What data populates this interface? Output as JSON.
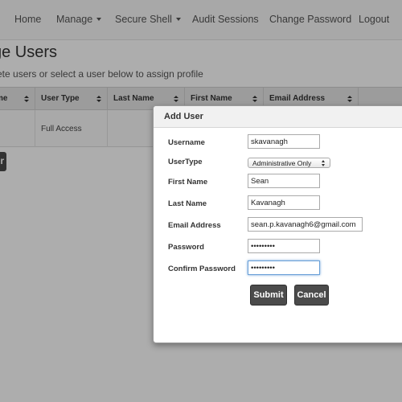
{
  "navbar": {
    "items": [
      {
        "label": "Home"
      },
      {
        "label": "Manage"
      },
      {
        "label": "Secure Shell"
      },
      {
        "label": "Audit Sessions"
      },
      {
        "label": "Change Password"
      },
      {
        "label": "Logout"
      }
    ]
  },
  "page": {
    "title": "ge Users",
    "subtitle": "ete users or select a user below to assign profile"
  },
  "table": {
    "headers": [
      "me",
      "User Type",
      "Last Name",
      "First Name",
      "Email Address"
    ],
    "rows": [
      {
        "name": "",
        "user_type": "Full Access",
        "last_name": "",
        "first_name": "",
        "email": ""
      }
    ]
  },
  "background_button": {
    "label": "r"
  },
  "modal": {
    "title": "Add User",
    "labels": {
      "username": "Username",
      "usertype": "UserType",
      "first_name": "First Name",
      "last_name": "Last Name",
      "email": "Email Address",
      "password": "Password",
      "confirm_password": "Confirm Password"
    },
    "values": {
      "username": "skavanagh",
      "usertype": "Administrative Only",
      "first_name": "Sean",
      "last_name": "Kavanagh",
      "email": "sean.p.kavanagh6@gmail.com",
      "password": "•••••••••",
      "confirm_password": "•••••••••"
    },
    "buttons": {
      "submit": "Submit",
      "cancel": "Cancel"
    }
  },
  "colors": {
    "navbar_bg": "#f8f8f8",
    "button_dark": "#4b4b4b",
    "focus_ring": "#6aa0d8"
  }
}
